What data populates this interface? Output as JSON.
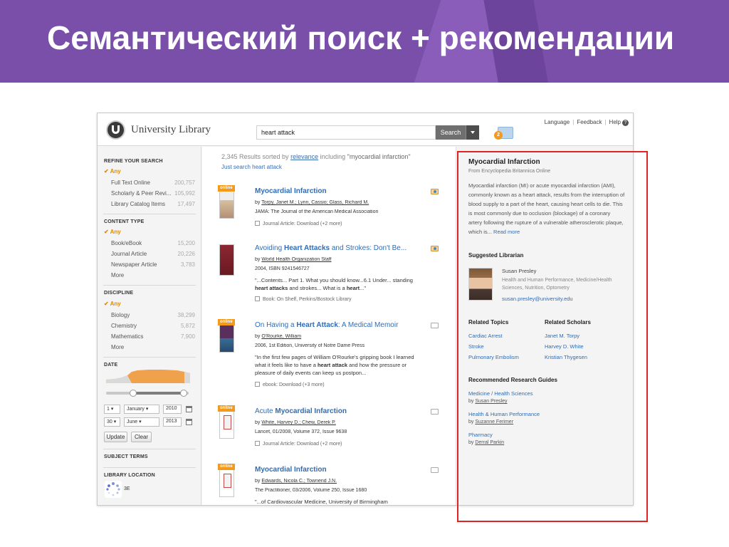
{
  "slide": {
    "title": "Семантический поиск + рекомендации"
  },
  "header": {
    "logo_text": "University Library",
    "search_value": "heart attack",
    "search_button": "Search",
    "folder_count": "2",
    "links": {
      "language": "Language",
      "feedback": "Feedback",
      "help": "Help"
    }
  },
  "sidebar": {
    "refine_title": "REFINE YOUR SEARCH",
    "refine_any": "✔ Any",
    "refine_items": [
      {
        "label": "Full Text Online",
        "count": "200,757"
      },
      {
        "label": "Scholarly & Peer Revi...",
        "count": "105,992"
      },
      {
        "label": "Library Catalog Items",
        "count": "17,497"
      }
    ],
    "content_title": "CONTENT TYPE",
    "content_any": "✔ Any",
    "content_items": [
      {
        "label": "Book/eBook",
        "count": "15,200"
      },
      {
        "label": "Journal Article",
        "count": "20,226"
      },
      {
        "label": "Newspaper Article",
        "count": "3,783"
      },
      {
        "label": "More",
        "count": ""
      }
    ],
    "discipline_title": "DISCIPLINE",
    "discipline_any": "✔ Any",
    "discipline_items": [
      {
        "label": "Biology",
        "count": "38,299"
      },
      {
        "label": "Chemistry",
        "count": "5,872"
      },
      {
        "label": "Mathematics",
        "count": "7,900"
      },
      {
        "label": "More",
        "count": ""
      }
    ],
    "date_title": "DATE",
    "date_from": {
      "day": "1",
      "month": "January",
      "year": "2010"
    },
    "date_to": {
      "day": "30",
      "month": "June",
      "year": "2013"
    },
    "update_button": "Update",
    "clear_button": "Clear",
    "subject_title": "SUBJECT TERMS",
    "location_title": "LIBRARY LOCATION",
    "location_partial": "3E"
  },
  "results": {
    "summary_count": "2,345 Results sorted by",
    "summary_sort": "relevance",
    "summary_incl": "including",
    "summary_query": "\"myocardial infarction\"",
    "just_search": "Just search heart attack",
    "items": [
      {
        "online": "online",
        "title_pre": "",
        "title_bold": "Myocardial Infarction",
        "title_post": "",
        "by_pre": "by ",
        "authors": "Torpy, Janet M.; Lynn, Cassio; Glass, Richard M.",
        "line2": "JAMA: The Journal of the American Medical Association",
        "snippet": "",
        "format": "Journal Article: Download (+2 more)"
      },
      {
        "online": "",
        "title_pre": "Avoiding ",
        "title_bold": "Heart Attacks",
        "title_post": " and Strokes: Don't Be...",
        "by_pre": "by ",
        "authors": "World Health Organization Staff",
        "line2": "2004, ISBN 9241546727",
        "snippet_1": "\"...Contents... Part 1. What you should know...6.1 Under... standing ",
        "snippet_b1": "heart attacks",
        "snippet_2": " and strokes... What is a ",
        "snippet_b2": "heart",
        "snippet_3": "...\"",
        "format": "Book: On Shelf, Perkins/Bostock Library"
      },
      {
        "online": "online",
        "title_pre": "On Having a ",
        "title_bold": "Heart Attack",
        "title_post": ": A Medical Memoir",
        "by_pre": "by ",
        "authors": "O'Rourke, William",
        "line2": "2006, 1st Edition, University of Notre Dame Press",
        "snippet_1": "\"In the first few pages of William O'Rourke's gripping book I learned what it feels like to have a ",
        "snippet_b1": "heart attack",
        "snippet_2": " and how the pressure or pleasure of daily events can keep us postpon...",
        "format": "ebook: Download (+3 more)"
      },
      {
        "online": "online",
        "title_pre": "Acute ",
        "title_bold": "Myocardial Infarction",
        "title_post": "",
        "by_pre": "by ",
        "authors": "White, Harvey D.; Chew, Derek P.",
        "line2": "Lancet, 01/2008, Volume 372, Issue 9638",
        "format": "Journal Article: Download (+2 more)"
      },
      {
        "online": "online",
        "title_pre": "",
        "title_bold": "Myocardial Infarction",
        "title_post": "",
        "by_pre": "by ",
        "authors": "Edwards, Nicola C.; Townend J.N.",
        "line2": "The Practitioner, 03/2006, Volume 250, Issue 1680",
        "snippet_1": "\"...of Cardiovascular Medicine, University of Birmingham"
      }
    ]
  },
  "recommender": {
    "topic_title": "Myocardial Infarction",
    "topic_source": "From Encyclopedia Britannica Online",
    "topic_text": "Myocardial infarction (MI) or acute myocardial infarction (AMI), commonly known as a heart attack, results from the interruption of blood supply to a part of the heart, causing heart cells to die. This is most commonly due to occlusion (blockage) of a coronary artery following the rupture of a vulnerable atherosclerotic plaque, which is...",
    "read_more": "Read more",
    "librarian_heading": "Suggested Librarian",
    "librarian_name": "Susan Presley",
    "librarian_dept": "Health and Human Performance, Medicine/Health Sciences, Nutrition, Optometry",
    "librarian_email": "susan.presley@university.edu",
    "topics_heading": "Related Topics",
    "topics": [
      "Cardiac Arrest",
      "Stroke",
      "Pulmonary Embolism"
    ],
    "scholars_heading": "Related Scholars",
    "scholars": [
      "Janet M. Torpy",
      "Harvey D. White",
      "Kristian Thygesen"
    ],
    "guides_heading": "Recommended Research Guides",
    "guides": [
      {
        "title": "Medicine / Health Sciences",
        "by": "by ",
        "author": "Susan Presley"
      },
      {
        "title": "Health & Human Performance",
        "by": "by ",
        "author": "Suzanne Ferimer"
      },
      {
        "title": "Pharmacy",
        "by": "by ",
        "author": "Derral Parkin"
      }
    ]
  },
  "colors": {
    "slide_purple": "#7a4fa9",
    "accent_orange": "#f39a1c",
    "link_blue": "#2f6cb5",
    "highlight_red": "#e02424"
  }
}
